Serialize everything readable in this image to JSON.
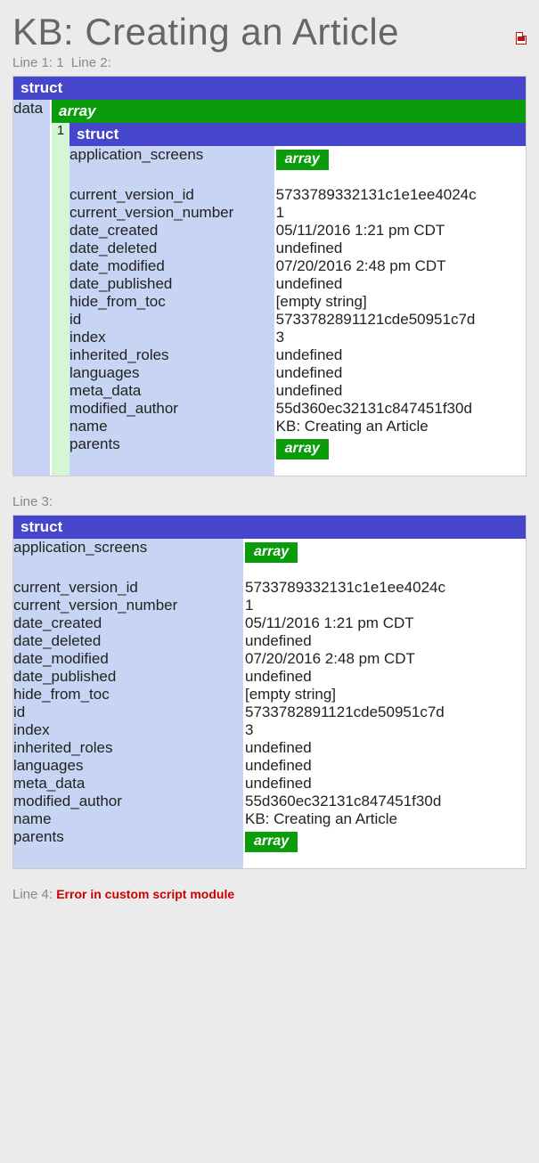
{
  "title": "KB: Creating an Article",
  "line1_label": "Line 1: 1",
  "line2_label": "Line 2:",
  "line3_label": "Line 3:",
  "line4_label": "Line 4:",
  "error_message": "Error in custom script module",
  "struct_label": "struct",
  "array_label": "array",
  "outer_key": "data",
  "array_index": "1",
  "rows": [
    {
      "k": "application_screens",
      "v": "__ARRAY__",
      "pad": true
    },
    {
      "k": "current_version_id",
      "v": "5733789332131c1e1ee4024c"
    },
    {
      "k": "current_version_number",
      "v": "1"
    },
    {
      "k": "date_created",
      "v": "05/11/2016 1:21 pm CDT"
    },
    {
      "k": "date_deleted",
      "v": "undefined"
    },
    {
      "k": "date_modified",
      "v": "07/20/2016 2:48 pm CDT"
    },
    {
      "k": "date_published",
      "v": "undefined"
    },
    {
      "k": "hide_from_toc",
      "v": "[empty string]"
    },
    {
      "k": "id",
      "v": "5733782891121cde50951c7d"
    },
    {
      "k": "index",
      "v": "3"
    },
    {
      "k": "inherited_roles",
      "v": "undefined"
    },
    {
      "k": "languages",
      "v": "undefined"
    },
    {
      "k": "meta_data",
      "v": "undefined"
    },
    {
      "k": "modified_author",
      "v": "55d360ec32131c847451f30d"
    },
    {
      "k": "name",
      "v": "KB: Creating an Article"
    },
    {
      "k": "parents",
      "v": "__ARRAY__",
      "pad": true
    }
  ]
}
